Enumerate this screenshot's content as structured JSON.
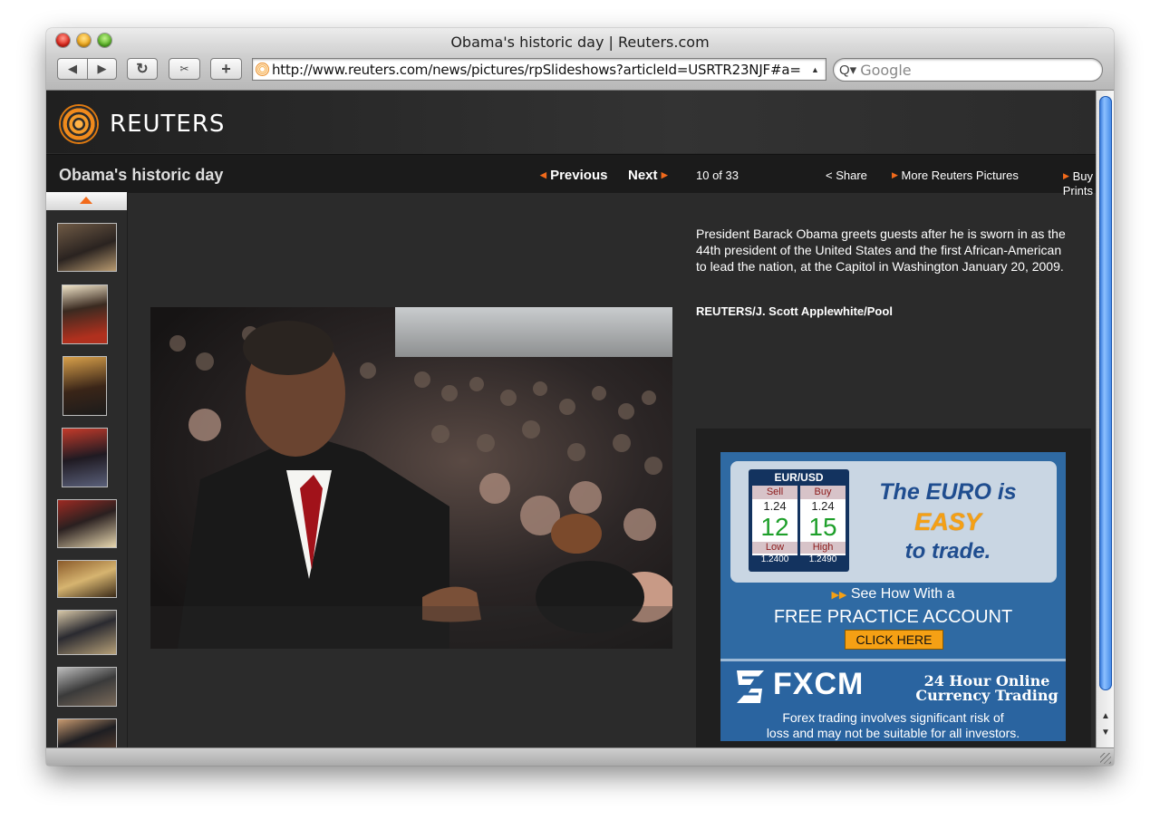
{
  "window": {
    "title": "Obama's historic day | Reuters.com"
  },
  "toolbar": {
    "back": "◀",
    "forward": "▶",
    "reload": "↻",
    "snapback": "✂",
    "add": "+",
    "url": "http://www.reuters.com/news/pictures/rpSlideshows?articleId=USRTR23NJF#a=",
    "search_placeholder": "Google",
    "search_icon": "Q▾"
  },
  "site": {
    "logo": "REUTERS"
  },
  "slideshow": {
    "title": "Obama's historic day",
    "previous": "Previous",
    "next": "Next",
    "counter": "10 of 33",
    "share": "Share",
    "more": "More Reuters Pictures",
    "buy": "Buy Prints",
    "caption": "President Barack Obama greets guests after he is sworn in as the 44th president of the United States and the first African-American to lead the nation, at the Capitol in Washington January 20, 2009.",
    "credit": "REUTERS/J. Scott Applewhite/Pool",
    "thumbnail_count": 9
  },
  "ad": {
    "pair": "EUR/USD",
    "sell_label": "Sell",
    "buy_label": "Buy",
    "sell_small": "1.24",
    "buy_small": "1.24",
    "sell_big": "12",
    "buy_big": "15",
    "low_label": "Low",
    "high_label": "High",
    "low_value": "1.2400",
    "high_value": "1.2490",
    "headline1": "The EURO is",
    "headline2": "EASY",
    "headline3": "to trade.",
    "see_how": "See How With a",
    "free_account": "FREE PRACTICE ACCOUNT",
    "click_here": "CLICK HERE",
    "brand": "FXCM",
    "tagline1": "24 Hour Online",
    "tagline2": "Currency Trading",
    "risk1": "Forex trading involves significant risk of",
    "risk2": "loss and may not be suitable for all investors."
  },
  "colors": {
    "accent": "#f26a1b",
    "ad_blue": "#2f6aa3",
    "ad_orange": "#f5a014"
  }
}
